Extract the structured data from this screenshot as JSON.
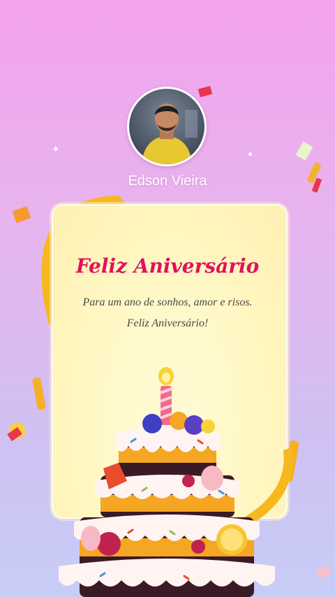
{
  "profile": {
    "name": "Edson Vieira"
  },
  "card": {
    "title": "Feliz Aniversário",
    "line1": "Para um ano de sonhos, amor e risos.",
    "line2": "Feliz Aniversário!"
  },
  "colors": {
    "title": "#e0115f",
    "background_top": "#f3a2ee",
    "background_bottom": "#c7cdf6",
    "card": "#fff7c2"
  },
  "icons": {
    "cake": "birthday-cake-icon",
    "candle": "candle-icon"
  }
}
